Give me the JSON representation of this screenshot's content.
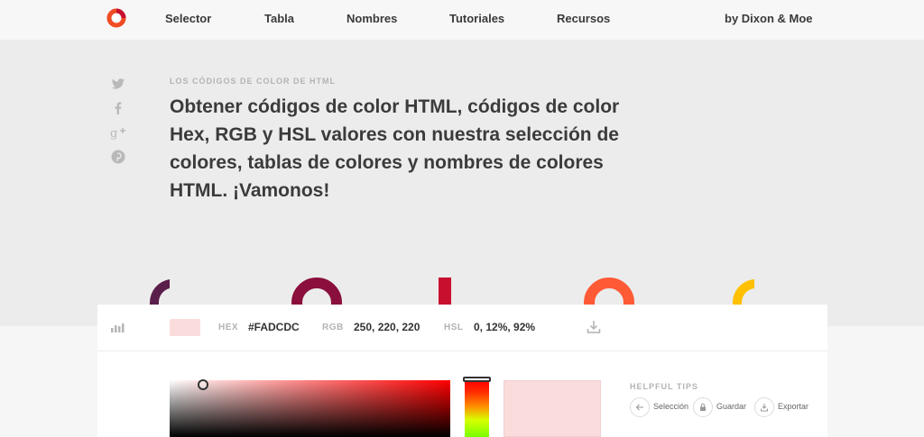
{
  "nav": {
    "items": [
      {
        "label": "Selector"
      },
      {
        "label": "Tabla"
      },
      {
        "label": "Nombres"
      },
      {
        "label": "Tutoriales"
      },
      {
        "label": "Recursos"
      }
    ],
    "credit": "by Dixon & Moe"
  },
  "hero": {
    "eyebrow": "LOS CÓDIGOS DE COLOR DE HTML",
    "headline": "Obtener códigos de color HTML, códigos de color Hex, RGB y HSL valores con nuestra selección de colores, tablas de colores y nombres de colores HTML. ¡Vamonos!",
    "social_icons": [
      "twitter-icon",
      "facebook-icon",
      "google-plus-icon",
      "pinterest-icon"
    ],
    "decor_colors": [
      "#5a1e4a",
      "#8a0f3c",
      "#c8102e",
      "#ff5a36",
      "#ffc000"
    ]
  },
  "picker": {
    "current_color": "#FADCDC",
    "hex_label": "HEX",
    "hex_value": "#FADCDC",
    "rgb_label": "RGB",
    "rgb_value": "250, 220, 220",
    "hsl_label": "HSL",
    "hsl_value": "0, 12%, 92%",
    "hue_color": "#ff0000"
  },
  "tips": {
    "title": "HELPFUL TIPS",
    "items": [
      {
        "label": "Selección",
        "icon": "arrow-left-icon"
      },
      {
        "label": "Guardar",
        "icon": "lock-icon"
      },
      {
        "label": "Exportar",
        "icon": "download-icon"
      }
    ]
  },
  "colors": {
    "logo_outer": "#f04b23",
    "logo_inner": "#c8102e"
  }
}
